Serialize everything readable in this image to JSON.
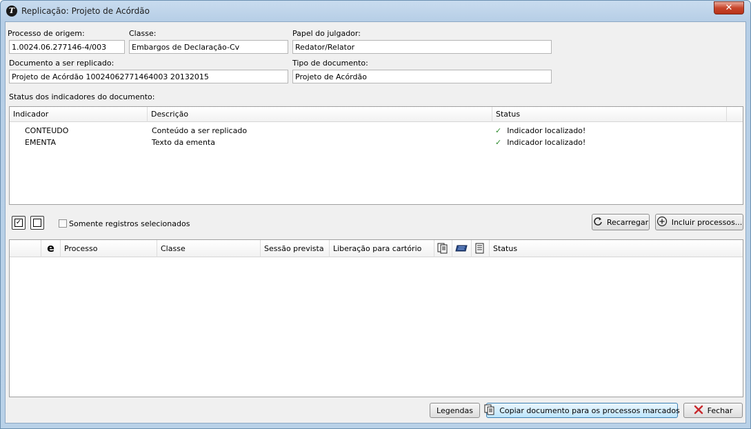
{
  "window": {
    "title": "Replicação: Projeto de Acórdão",
    "close_glyph": "✕"
  },
  "form": {
    "processo_origem": {
      "label": "Processo de origem:",
      "value": "1.0024.06.277146-4/003"
    },
    "classe": {
      "label": "Classe:",
      "value": "Embargos de Declaração-Cv"
    },
    "papel": {
      "label": "Papel do julgador:",
      "value": "Redator/Relator"
    },
    "documento": {
      "label": "Documento a ser replicado:",
      "value": "Projeto de Acórdão 10024062771464003 20132015"
    },
    "tipo": {
      "label": "Tipo de documento:",
      "value": "Projeto de Acórdão"
    },
    "status_label": "Status dos indicadores do documento:"
  },
  "indicators": {
    "headers": {
      "indicador": "Indicador",
      "descricao": "Descrição",
      "status": "Status"
    },
    "rows": [
      {
        "indicador": "CONTEUDO",
        "descricao": "Conteúdo a ser replicado",
        "status": "Indicador localizado!"
      },
      {
        "indicador": "EMENTA",
        "descricao": "Texto da ementa",
        "status": "Indicador localizado!"
      }
    ]
  },
  "toolbar": {
    "somente_label": "Somente registros selecionados",
    "recarregar_label": "Recarregar",
    "incluir_label": "Incluir processos..."
  },
  "processes": {
    "headers": {
      "e_icon": "e",
      "processo": "Processo",
      "classe": "Classe",
      "sessao": "Sessão prevista",
      "liberacao": "Liberação para cartório",
      "status": "Status"
    }
  },
  "footer": {
    "legendas_label": "Legendas",
    "copiar_label": "Copiar documento para os processos marcados",
    "fechar_label": "Fechar"
  },
  "icons": {
    "app": "T",
    "check": "✓"
  },
  "colors": {
    "check": "#2d8a2d",
    "close": "#c8462c"
  }
}
